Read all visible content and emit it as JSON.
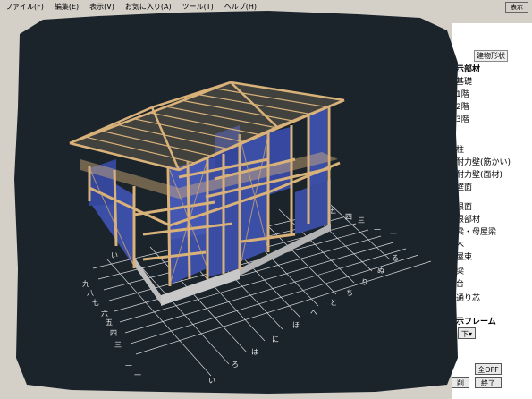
{
  "menu": {
    "items": [
      "ファイル(F)",
      "編集(E)",
      "表示(V)",
      "お気に入り(A)",
      "ツール(T)",
      "ヘルプ(H)"
    ],
    "top_right_button": "表示"
  },
  "panel": {
    "tab_label": "建物形状",
    "items": [
      {
        "label": "示部材",
        "heading": true
      },
      {
        "label": "基礎"
      },
      {
        "label": "1階"
      },
      {
        "label": "2階"
      },
      {
        "label": "3階"
      },
      {
        "label": "柱"
      },
      {
        "label": "耐力壁(筋かい)"
      },
      {
        "label": "耐力壁(面材)"
      },
      {
        "label": "壁面"
      },
      {
        "label": "根面"
      },
      {
        "label": "根部材"
      },
      {
        "label": "梁・母屋梁"
      },
      {
        "label": "木"
      },
      {
        "label": "屋束"
      },
      {
        "label": "梁"
      },
      {
        "label": "台"
      },
      {
        "label": "通り芯"
      },
      {
        "label": "示フレーム",
        "heading": true
      }
    ],
    "buttons": {
      "all_off": "全OFF",
      "finish": "終了",
      "left_partial": "削"
    },
    "select_value": "下"
  },
  "grid_labels": {
    "kanji_row": [
      "五",
      "四",
      "三",
      "二",
      "一",
      "八",
      "七",
      "六"
    ],
    "kana_row": [
      "い",
      "ろ",
      "は",
      "に",
      "ほ",
      "へ",
      "と",
      "ち",
      "り",
      "ぬ",
      "る"
    ]
  },
  "colors": {
    "background": "#1b232b",
    "wall_panel": "#3c4fa6",
    "timber": "#d9b27a",
    "foundation": "#c8c8c8",
    "grid_lines": "#d9d9d9"
  }
}
